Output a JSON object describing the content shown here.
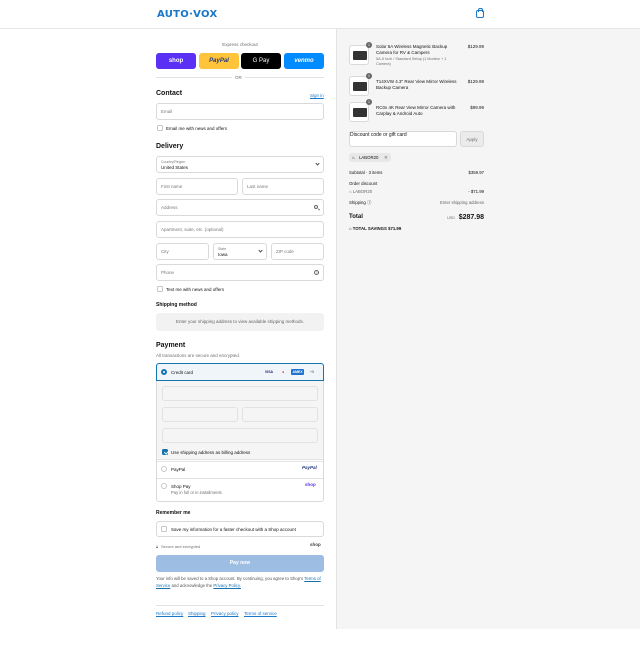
{
  "brand": {
    "logo": "AUTO·VOX",
    "accent": "#1877c9"
  },
  "express": {
    "label": "Express checkout",
    "buttons": [
      {
        "label": "shop",
        "color": "#5a31f4"
      },
      {
        "label": "PayPal",
        "color": "#ffc439"
      },
      {
        "label": "G Pay",
        "color": "#000000"
      },
      {
        "label": "venmo",
        "color": "#008cff"
      }
    ],
    "or": "OR"
  },
  "contact": {
    "title": "Contact",
    "sign_in": "Sign in",
    "email_placeholder": "Email",
    "news_label": "Email me with news and offers"
  },
  "delivery": {
    "title": "Delivery",
    "country_label": "Country/Region",
    "country_value": "United States",
    "first_name": "First name",
    "last_name": "Last name",
    "address": "Address",
    "apartment": "Apartment, suite, etc. (optional)",
    "city": "City",
    "state_label": "State",
    "state_value": "Iowa",
    "zip": "ZIP code",
    "phone": "Phone",
    "text_label": "Text me with news and offers"
  },
  "shipping_method": {
    "title": "Shipping method",
    "note": "Enter your shipping address to view available shipping methods."
  },
  "payment": {
    "title": "Payment",
    "subtitle": "All transactions are secure and encrypted.",
    "credit_card": "Credit card",
    "card_brands": [
      "VISA",
      "MC",
      "AMEX",
      "+5"
    ],
    "billing_same": "Use shipping address as billing address",
    "paypal": "PayPal",
    "paypal_logo": "PayPal",
    "shop_pay": "Shop Pay",
    "shop_pay_sub": "Pay in full or in installments",
    "shop_logo": "shop"
  },
  "remember": {
    "title": "Remember me",
    "save_label": "Save my information for a faster checkout with a Shop account",
    "secure": "Secure and encrypted",
    "shop_logo": "shop"
  },
  "pay_now": "Pay now",
  "legal": {
    "line1": "Your info will be saved to a Shop account. By continuing, you agree to Shop's",
    "terms": "Terms of Service",
    "and": "and acknowledge the",
    "privacy": "Privacy Policy."
  },
  "footer_links": [
    "Refund policy",
    "Shipping",
    "Privacy policy",
    "Terms of service"
  ],
  "cart": {
    "items": [
      {
        "qty": "1",
        "title": "Solar 5A Wireless Magnetic Backup Camera for RV & Campers",
        "variant": "5A-5 Inch / Standard Setup (1 Monitor + 1 Camera)",
        "price": "$129.99"
      },
      {
        "qty": "1",
        "title": "T14XVW 4.3\" Rear View Mirror Wireless Backup Camera",
        "variant": "",
        "price": "$129.99"
      },
      {
        "qty": "1",
        "title": "RC0x 4K Rear View Mirror Camera with Carplay & Android Auto",
        "variant": "",
        "price": "$99.99"
      }
    ],
    "discount_placeholder": "Discount code or gift card",
    "apply": "Apply",
    "code_tag": "LABOR20",
    "subtotal_label": "Subtotal · 3 items",
    "subtotal": "$359.97",
    "order_discount_label": "Order discount",
    "order_discount_code": "LABOR20",
    "order_discount_value": "- $71.99",
    "shipping_label": "Shipping",
    "shipping_value": "Enter shipping address",
    "total_label": "Total",
    "currency": "USD",
    "total": "$287.98",
    "savings_label": "TOTAL SAVINGS",
    "savings": "$71.99"
  }
}
